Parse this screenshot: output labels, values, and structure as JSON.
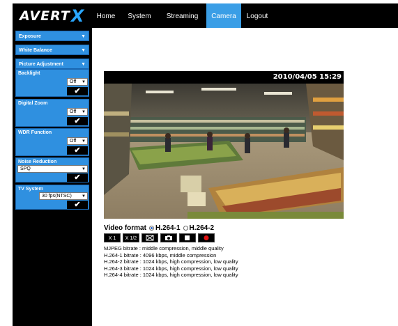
{
  "brand": {
    "logo_text": "AVERT",
    "logo_x": "X"
  },
  "nav": {
    "items": [
      {
        "label": "Home"
      },
      {
        "label": "System"
      },
      {
        "label": "Streaming"
      },
      {
        "label": "Camera",
        "active": true
      },
      {
        "label": "Logout"
      }
    ]
  },
  "sidebar": {
    "exposure": "Exposure",
    "white_balance": "White Balance",
    "picture_adjustment": "Picture Adjustment",
    "backlight": {
      "title": "Backlight",
      "value": "Off"
    },
    "digital_zoom": {
      "title": "Digital Zoom",
      "value": "Off"
    },
    "wdr": {
      "title": "WDR Function",
      "value": "Off"
    },
    "noise_reduction": {
      "title": "Noise Reduction",
      "value": "SPQ"
    },
    "tv_system": {
      "title": "TV System",
      "value": "30 fps(NTSC)"
    },
    "apply_glyph": "✔"
  },
  "video": {
    "timestamp": "2010/04/05 15:29"
  },
  "format": {
    "label": "Video format",
    "option1": "H.264-1",
    "option2": "H.264-2",
    "selected": "H.264-1"
  },
  "controls": {
    "zoom1": "X 1",
    "zoom_half": "X 1/2"
  },
  "bitrates": [
    "MJPEG bitrate : middle compression, middle quality",
    "H.264-1 bitrate : 4096 kbps, middle compression",
    "H.264-2 bitrate : 1024 kbps, high compression, low quality",
    "H.264-3 bitrate : 1024 kbps, high compression, low quality",
    "H.264-4 bitrate : 1024 kbps, high compression, low quality"
  ],
  "colors": {
    "accent": "#3a9ee6",
    "panel": "#2f90e0",
    "record": "#e01010"
  }
}
